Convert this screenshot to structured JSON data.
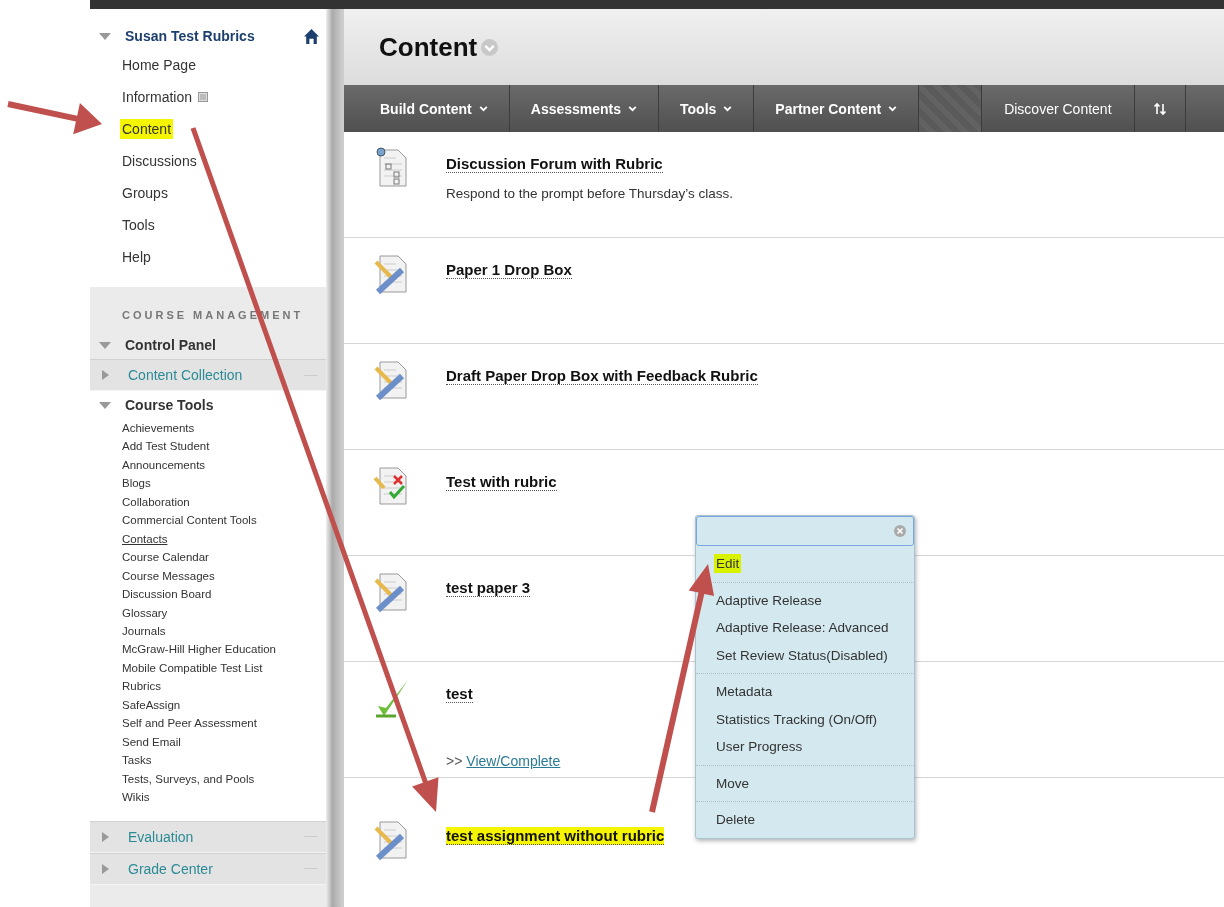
{
  "sidebar": {
    "course_title": "Susan Test Rubrics",
    "expanded": true,
    "menu": [
      {
        "label": "Home Page",
        "kind": "link",
        "highlighted": false
      },
      {
        "label": "Information",
        "kind": "page",
        "highlighted": false
      },
      {
        "label": "Content",
        "kind": "link",
        "highlighted": true
      },
      {
        "label": "Discussions",
        "kind": "link",
        "highlighted": false
      },
      {
        "label": "Groups",
        "kind": "link",
        "highlighted": false
      },
      {
        "label": "Tools",
        "kind": "link",
        "highlighted": false
      },
      {
        "label": "Help",
        "kind": "link",
        "highlighted": false
      }
    ],
    "management": {
      "heading": "COURSE MANAGEMENT",
      "panel_title": "Control Panel",
      "expanded": true,
      "sections": [
        {
          "label": "Content Collection",
          "kind": "link",
          "expanded": false
        },
        {
          "label": "Course Tools",
          "kind": "group",
          "expanded": true,
          "items": [
            {
              "label": "Achievements",
              "hovered": false
            },
            {
              "label": "Add Test Student",
              "hovered": false
            },
            {
              "label": "Announcements",
              "hovered": false
            },
            {
              "label": "Blogs",
              "hovered": false
            },
            {
              "label": "Collaboration",
              "hovered": false
            },
            {
              "label": "Commercial Content Tools",
              "hovered": false
            },
            {
              "label": "Contacts",
              "hovered": true
            },
            {
              "label": "Course Calendar",
              "hovered": false
            },
            {
              "label": "Course Messages",
              "hovered": false
            },
            {
              "label": "Discussion Board",
              "hovered": false
            },
            {
              "label": "Glossary",
              "hovered": false
            },
            {
              "label": "Journals",
              "hovered": false
            },
            {
              "label": "McGraw-Hill Higher Education",
              "hovered": false
            },
            {
              "label": "Mobile Compatible Test List",
              "hovered": false
            },
            {
              "label": "Rubrics",
              "hovered": false
            },
            {
              "label": "SafeAssign",
              "hovered": false
            },
            {
              "label": "Self and Peer Assessment",
              "hovered": false
            },
            {
              "label": "Send Email",
              "hovered": false
            },
            {
              "label": "Tasks",
              "hovered": false
            },
            {
              "label": "Tests, Surveys, and Pools",
              "hovered": false
            },
            {
              "label": "Wikis",
              "hovered": false
            }
          ]
        },
        {
          "label": "Evaluation",
          "kind": "link",
          "expanded": false
        },
        {
          "label": "Grade Center",
          "kind": "link",
          "expanded": false
        }
      ]
    }
  },
  "page_title": "Content",
  "toolbar": [
    {
      "label": "Build Content",
      "kind": "menu"
    },
    {
      "label": "Assessments",
      "kind": "menu"
    },
    {
      "label": "Tools",
      "kind": "menu"
    },
    {
      "label": "Partner Content",
      "kind": "menu"
    },
    {
      "kind": "spacer"
    },
    {
      "label": "Discover Content",
      "kind": "plain"
    },
    {
      "kind": "sort"
    }
  ],
  "items": [
    {
      "title": "Discussion Forum with Rubric",
      "kind": "forum",
      "description": "Respond to the prompt before Thursday’s class.",
      "highlighted": false
    },
    {
      "title": "Paper 1 Drop Box",
      "kind": "assignment",
      "highlighted": false
    },
    {
      "title": "Draft Paper Drop Box with Feedback Rubric",
      "kind": "assignment",
      "highlighted": false
    },
    {
      "title": "Test with rubric",
      "kind": "test",
      "highlighted": false
    },
    {
      "title": "test paper 3",
      "kind": "assignment",
      "highlighted": false
    },
    {
      "title": "test",
      "kind": "survey",
      "link_prefix": ">>",
      "link": "View/Complete",
      "highlighted": false
    },
    {
      "title": "test assignment without rubric",
      "kind": "assignment",
      "highlighted": true
    }
  ],
  "context_menu": {
    "groups": [
      [
        {
          "label": "Edit",
          "highlighted": true
        }
      ],
      [
        {
          "label": "Adaptive Release",
          "highlighted": false
        },
        {
          "label": "Adaptive Release: Advanced",
          "highlighted": false
        },
        {
          "label": "Set Review Status(Disabled)",
          "highlighted": false
        }
      ],
      [
        {
          "label": "Metadata",
          "highlighted": false
        },
        {
          "label": "Statistics Tracking (On/Off)",
          "highlighted": false
        },
        {
          "label": "User Progress",
          "highlighted": false
        }
      ],
      [
        {
          "label": "Move",
          "highlighted": false
        }
      ],
      [
        {
          "label": "Delete",
          "highlighted": false
        }
      ]
    ]
  }
}
